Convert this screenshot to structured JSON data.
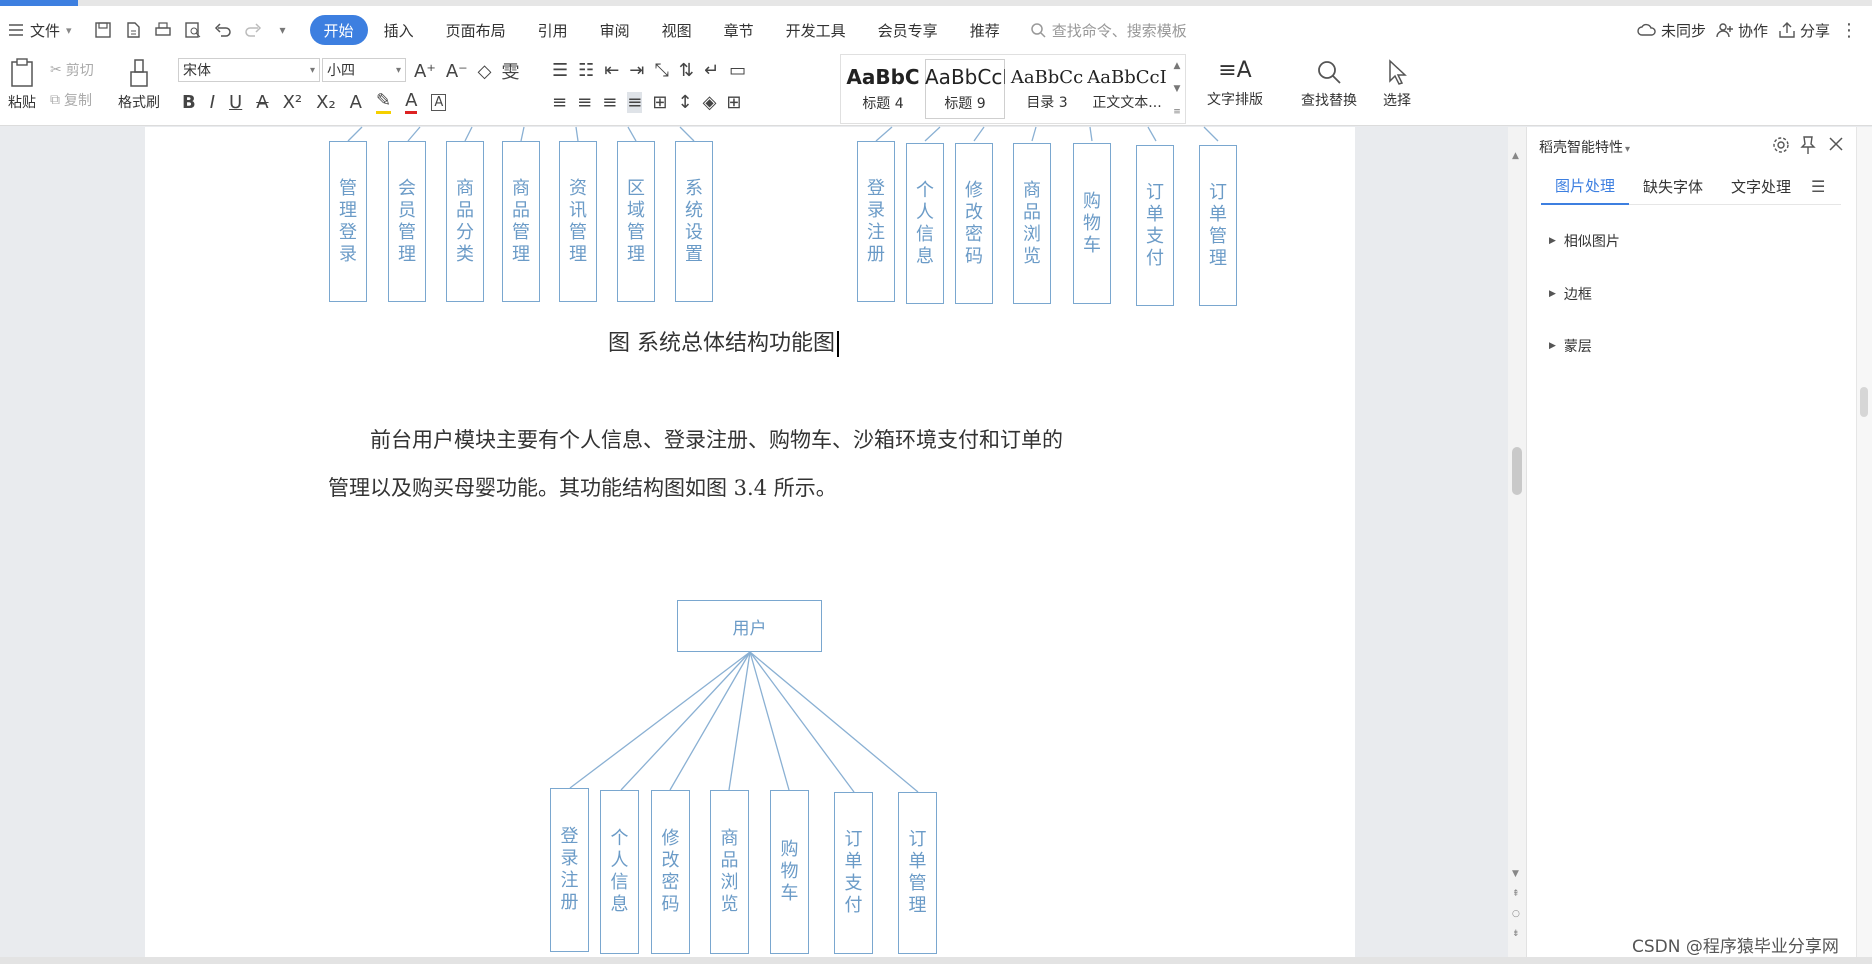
{
  "menu": {
    "file": "文件",
    "tabs": [
      "开始",
      "插入",
      "页面布局",
      "引用",
      "审阅",
      "视图",
      "章节",
      "开发工具",
      "会员专享",
      "推荐"
    ],
    "search_placeholder": "查找命令、搜索模板",
    "sync": "未同步",
    "collab": "协作",
    "share": "分享"
  },
  "toolbar": {
    "paste": "粘贴",
    "cut": "剪切",
    "copy": "复制",
    "format_painter": "格式刷",
    "font": "宋体",
    "size": "小四",
    "styles": [
      {
        "preview": "AaBbC",
        "label": "标题 4"
      },
      {
        "preview": "AaBbCcI",
        "label": "标题 9"
      },
      {
        "preview": "AaBbCc",
        "label": "目录 3"
      },
      {
        "preview": "AaBbCcI",
        "label": "正文文本..."
      }
    ],
    "text_layout": "文字排版",
    "find_replace": "查找替换",
    "select": "选择"
  },
  "document": {
    "top_left_boxes": [
      "管理登录",
      "会员管理",
      "商品分类",
      "商品管理",
      "资讯管理",
      "区域管理",
      "系统设置"
    ],
    "top_right_boxes": [
      "登录注册",
      "个人信息",
      "修改密码",
      "商品浏览",
      "购物车",
      "订单支付",
      "订单管理"
    ],
    "caption": "图  系统总体结构功能图",
    "paragraph_line1": "前台用户模块主要有个人信息、登录注册、购物车、沙箱环境支付和订单的",
    "paragraph_line2": "管理以及购买母婴功能。其功能结构图如图 3.4 所示。",
    "root_box": "用户",
    "bottom_boxes": [
      "登录注册",
      "个人信息",
      "修改密码",
      "商品浏览",
      "购物车",
      "订单支付",
      "订单管理"
    ]
  },
  "panel": {
    "title": "稻壳智能特性",
    "tabs": [
      "图片处理",
      "缺失字体",
      "文字处理"
    ],
    "sections": [
      "相似图片",
      "边框",
      "蒙层"
    ]
  },
  "watermark": "CSDN @程序猿毕业分享网"
}
